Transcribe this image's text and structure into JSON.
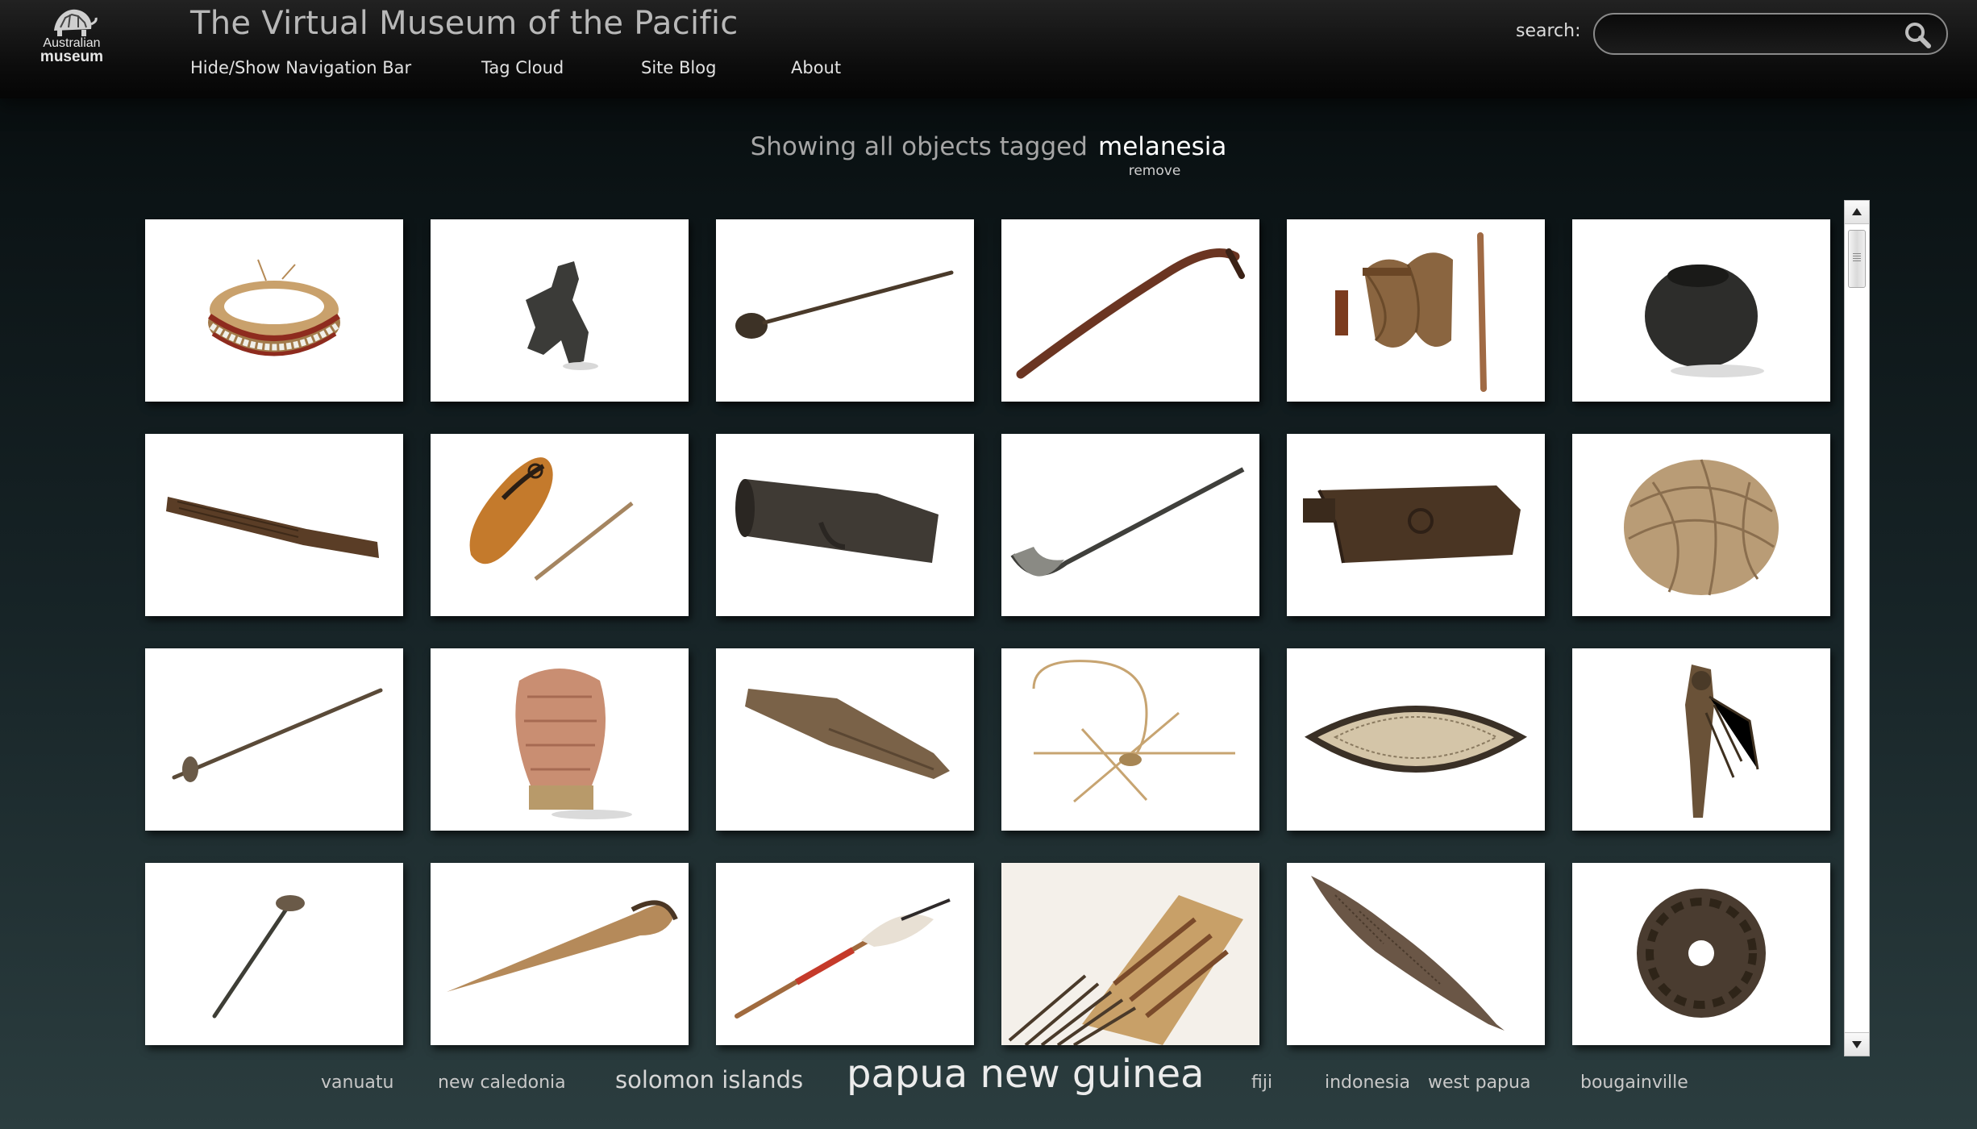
{
  "header": {
    "logo_line1": "Australian",
    "logo_line2": "museum",
    "title": "The Virtual Museum of the Pacific",
    "nav": [
      {
        "label": "Hide/Show Navigation Bar"
      },
      {
        "label": "Tag Cloud"
      },
      {
        "label": "Site Blog"
      },
      {
        "label": "About"
      }
    ],
    "search": {
      "label": "search:",
      "value": "",
      "placeholder": ""
    }
  },
  "filter": {
    "prefix": "Showing all objects tagged",
    "tag": "melanesia",
    "remove_label": "remove"
  },
  "tag_cloud": [
    {
      "label": "vanuatu"
    },
    {
      "label": "new caledonia"
    },
    {
      "label": "solomon islands"
    },
    {
      "label": "papua new guinea"
    },
    {
      "label": "fiji"
    },
    {
      "label": "indonesia"
    },
    {
      "label": "west papua"
    },
    {
      "label": "bougainville"
    }
  ],
  "colors": {
    "background_top": "#05090a",
    "background_bottom": "#2b3d3f",
    "header": "#0d0d0d",
    "thumbnail_bg": "#ffffff"
  }
}
